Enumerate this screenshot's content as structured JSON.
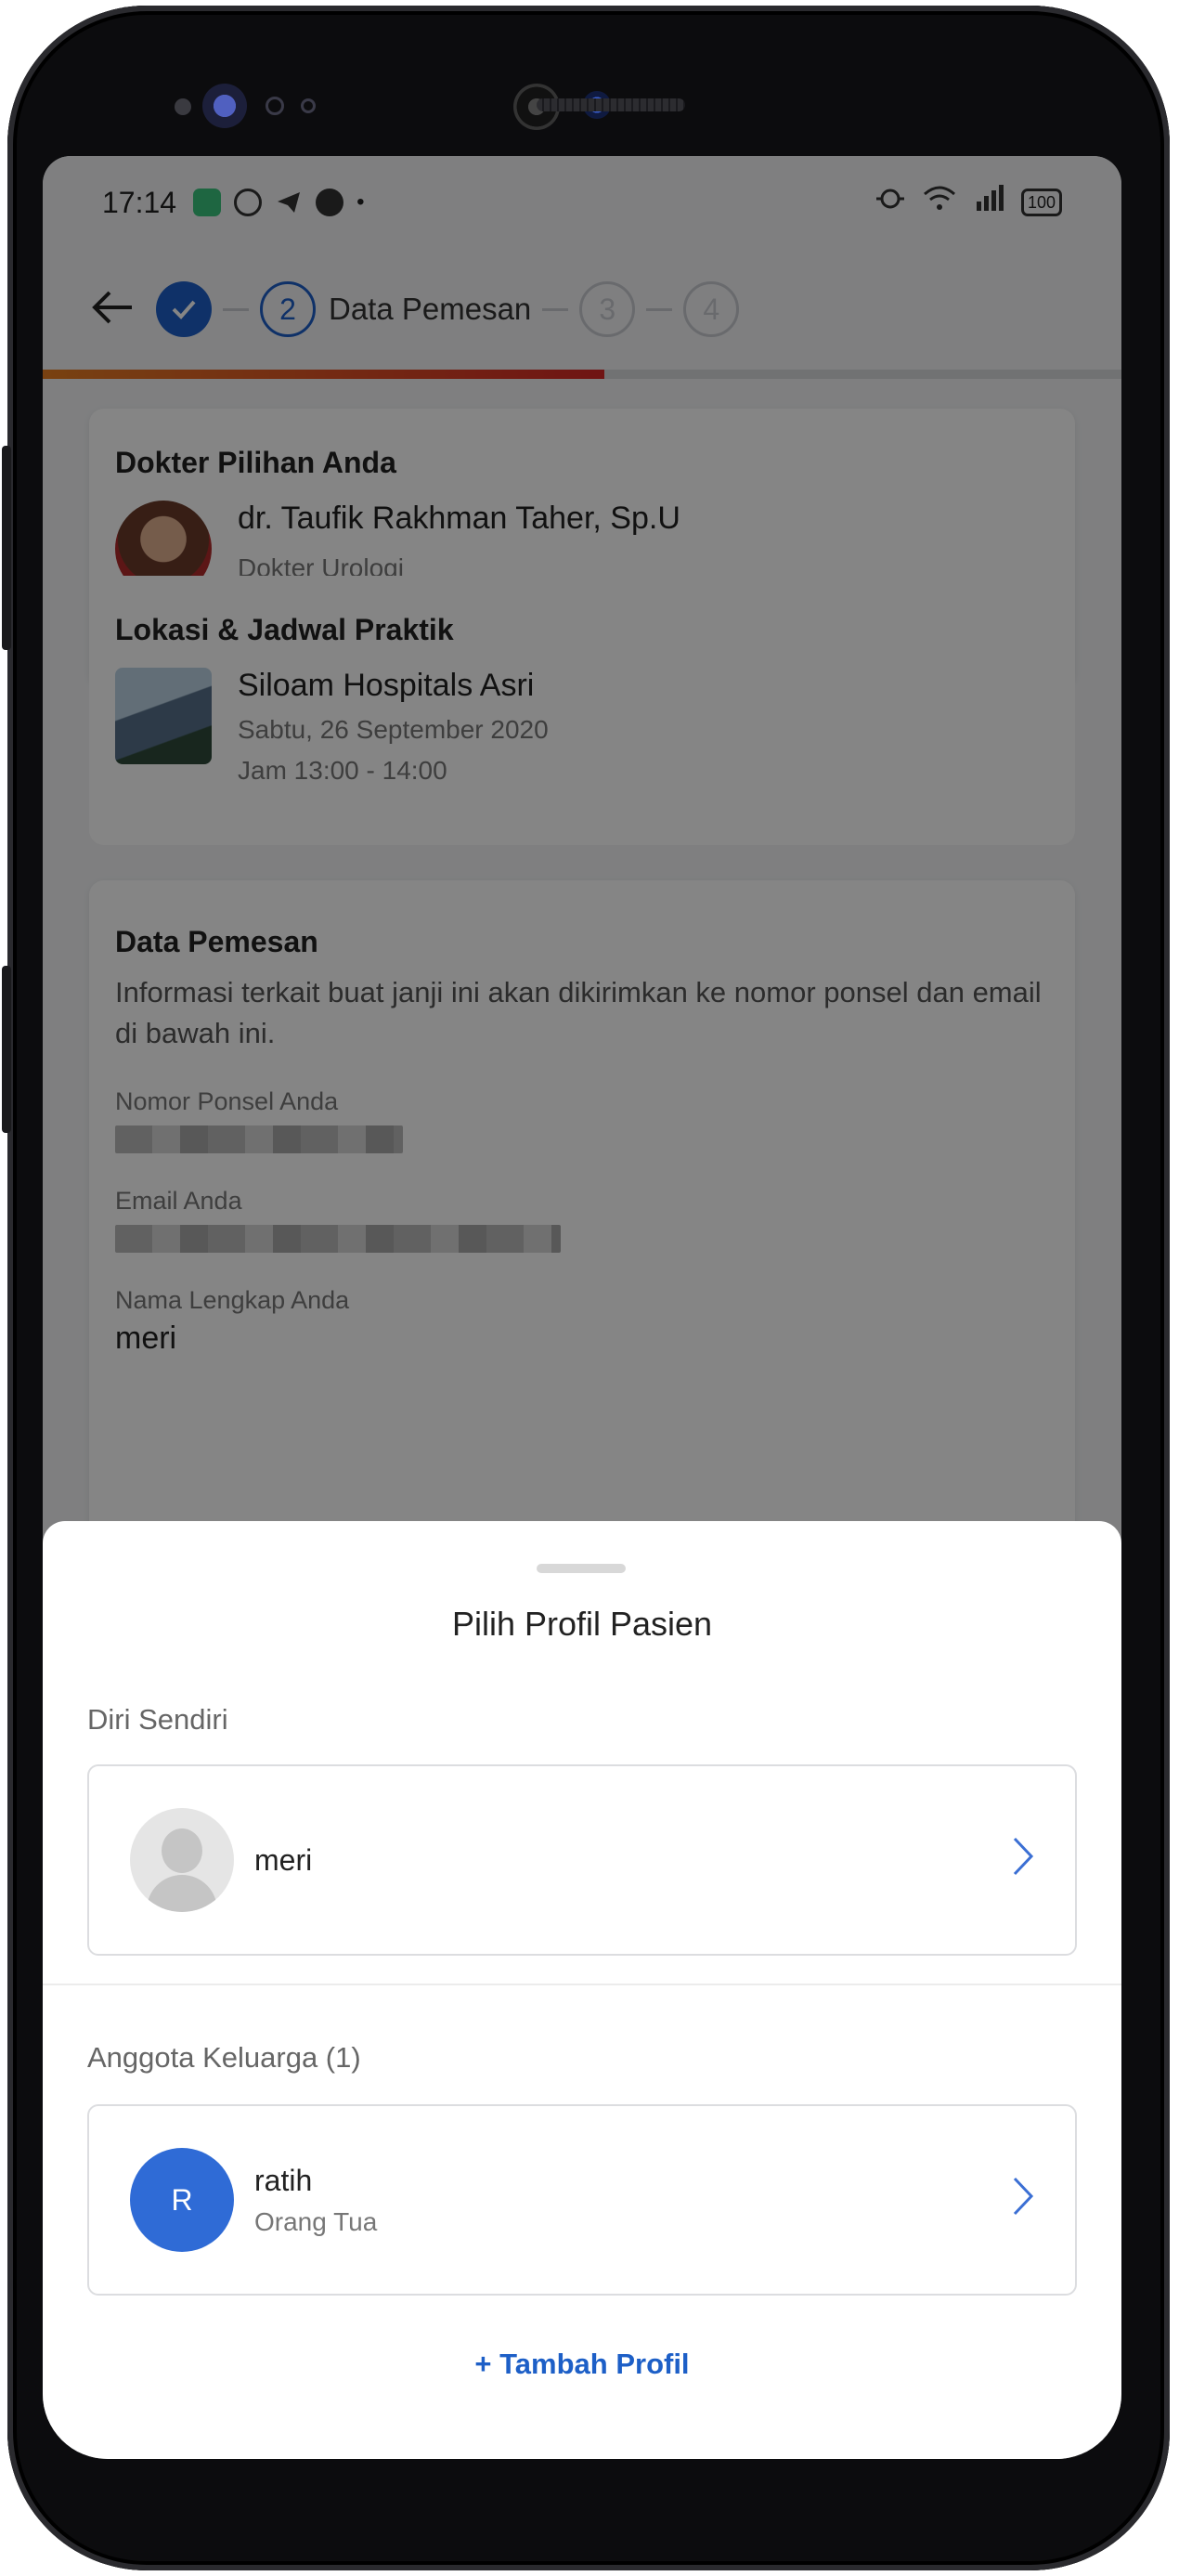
{
  "status_bar": {
    "time": "17:14",
    "battery": "100"
  },
  "stepper": {
    "current_step_number": "2",
    "current_step_label": "Data Pemesan",
    "step3": "3",
    "step4": "4"
  },
  "doctor_card": {
    "title": "Dokter Pilihan Anda",
    "doctor_name": "dr. Taufik Rakhman Taher, Sp.U",
    "specialty": "Dokter Urologi",
    "location_title": "Lokasi & Jadwal Praktik",
    "hospital": "Siloam Hospitals Asri",
    "date": "Sabtu, 26 September 2020",
    "time": "Jam 13:00 - 14:00"
  },
  "booker_card": {
    "title": "Data Pemesan",
    "description": "Informasi terkait buat janji ini akan dikirimkan ke nomor ponsel dan email di bawah ini.",
    "phone_label": "Nomor Ponsel Anda",
    "email_label": "Email Anda",
    "name_label": "Nama Lengkap Anda",
    "name_value": "meri"
  },
  "sheet": {
    "title": "Pilih Profil Pasien",
    "self_label": "Diri Sendiri",
    "self_profile": {
      "name": "meri"
    },
    "family_label": "Anggota Keluarga (1)",
    "family_profiles": [
      {
        "initial": "R",
        "name": "ratih",
        "relation": "Orang Tua"
      }
    ],
    "add_profile": "Tambah Profil",
    "add_icon": "+"
  },
  "colors": {
    "primary": "#1d5fc7",
    "progress_start": "#e67e22",
    "progress_end": "#d62828"
  }
}
